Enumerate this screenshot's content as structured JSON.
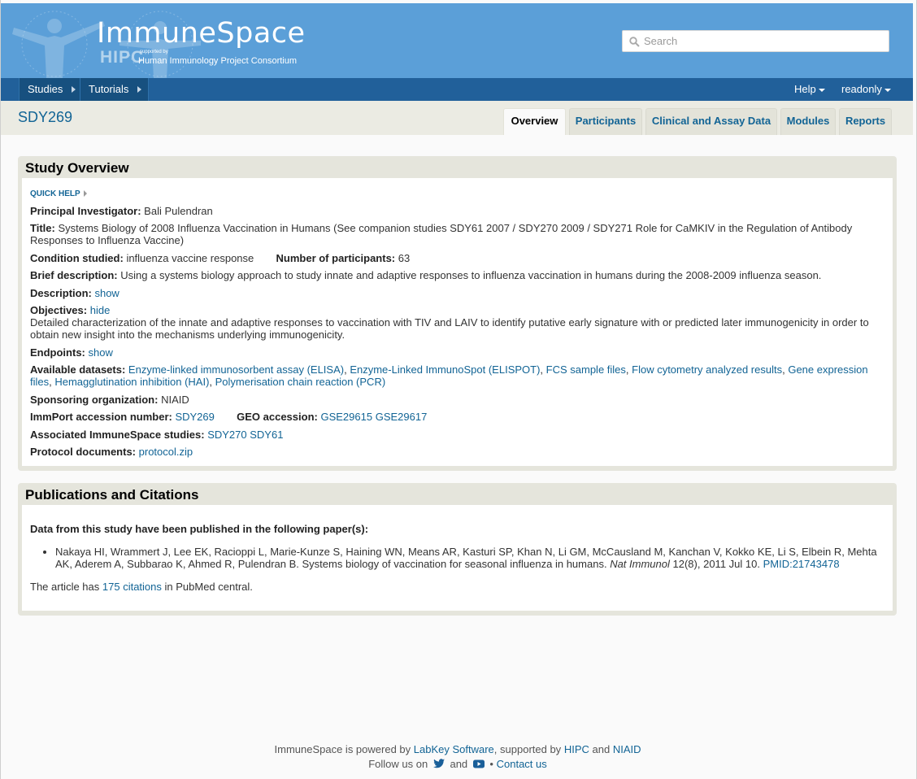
{
  "header": {
    "logo_title": "ImmuneSpace",
    "logo_hipc": "HIPC",
    "logo_supported_by": "supported by",
    "logo_subtitle": "Human Immunology Project Consortium",
    "search_placeholder": "Search"
  },
  "menubar": {
    "left": [
      "Studies",
      "Tutorials"
    ],
    "right": [
      "Help",
      "readonly"
    ]
  },
  "page": {
    "study_id": "SDY269",
    "tabs": [
      "Overview",
      "Participants",
      "Clinical and Assay Data",
      "Modules",
      "Reports"
    ],
    "active_tab": "Overview"
  },
  "overview": {
    "heading": "Study Overview",
    "quick_help": "QUICK HELP",
    "pi_label": "Principal Investigator:",
    "pi_value": "Bali Pulendran",
    "title_label": "Title:",
    "title_value": "Systems Biology of 2008 Influenza Vaccination in Humans (See companion studies SDY61 2007 / SDY270 2009 / SDY271 Role for CaMKIV in the Regulation of Antibody Responses to Influenza Vaccine)",
    "condition_label": "Condition studied:",
    "condition_value": "influenza vaccine response",
    "participants_label": "Number of participants:",
    "participants_value": "63",
    "brief_label": "Brief description:",
    "brief_value": "Using a systems biology approach to study innate and adaptive responses to influenza vaccination in humans during the 2008-2009 influenza season.",
    "description_label": "Description:",
    "description_link": "show",
    "objectives_label": "Objectives:",
    "objectives_link": "hide",
    "objectives_text": "Detailed characterization of the innate and adaptive responses to vaccination with TIV and LAIV to identify putative early signature with or predicted later immunogenicity in order to obtain new insight into the mechanisms underlying immunogenicity.",
    "endpoints_label": "Endpoints:",
    "endpoints_link": "show",
    "datasets_label": "Available datasets:",
    "datasets": [
      "Enzyme-linked immunosorbent assay (ELISA)",
      "Enzyme-Linked ImmunoSpot (ELISPOT)",
      "FCS sample files",
      "Flow cytometry analyzed results",
      "Gene expression files",
      "Hemagglutination inhibition (HAI)",
      "Polymerisation chain reaction (PCR)"
    ],
    "sponsor_label": "Sponsoring organization:",
    "sponsor_value": "NIAID",
    "immport_label": "ImmPort accession number:",
    "immport_value": "SDY269",
    "geo_label": "GEO accession:",
    "geo_values": [
      "GSE29615",
      "GSE29617"
    ],
    "assoc_label": "Associated ImmuneSpace studies:",
    "assoc_values": [
      "SDY270",
      "SDY61"
    ],
    "protocol_label": "Protocol documents:",
    "protocol_value": "protocol.zip"
  },
  "publications": {
    "heading": "Publications and Citations",
    "intro": "Data from this study have been published in the following paper(s):",
    "citation_text": "Nakaya HI, Wrammert J, Lee EK, Racioppi L, Marie-Kunze S, Haining WN, Means AR, Kasturi SP, Khan N, Li GM, McCausland M, Kanchan V, Kokko KE, Li S, Elbein R, Mehta AK, Aderem A, Subbarao K, Ahmed R, Pulendran B. Systems biology of vaccination for seasonal influenza in humans.",
    "journal": "Nat Immunol",
    "issue": "12(8), 2011 Jul 10.",
    "pmid": "PMID:21743478",
    "citations_prefix": "The article has",
    "citations_link": "175 citations",
    "citations_suffix": "in PubMed central."
  },
  "footer": {
    "powered_prefix": "ImmuneSpace is powered by",
    "labkey": "LabKey Software",
    "supported_by": ", supported by",
    "hipc": "HIPC",
    "and1": "and",
    "niaid": "NIAID",
    "follow": "Follow us on",
    "and2": "and",
    "bullet": "•",
    "contact": "Contact us"
  },
  "colors": {
    "header_bg": "#5b9fd8",
    "menubar_bg": "#21609a",
    "link": "#126495"
  }
}
